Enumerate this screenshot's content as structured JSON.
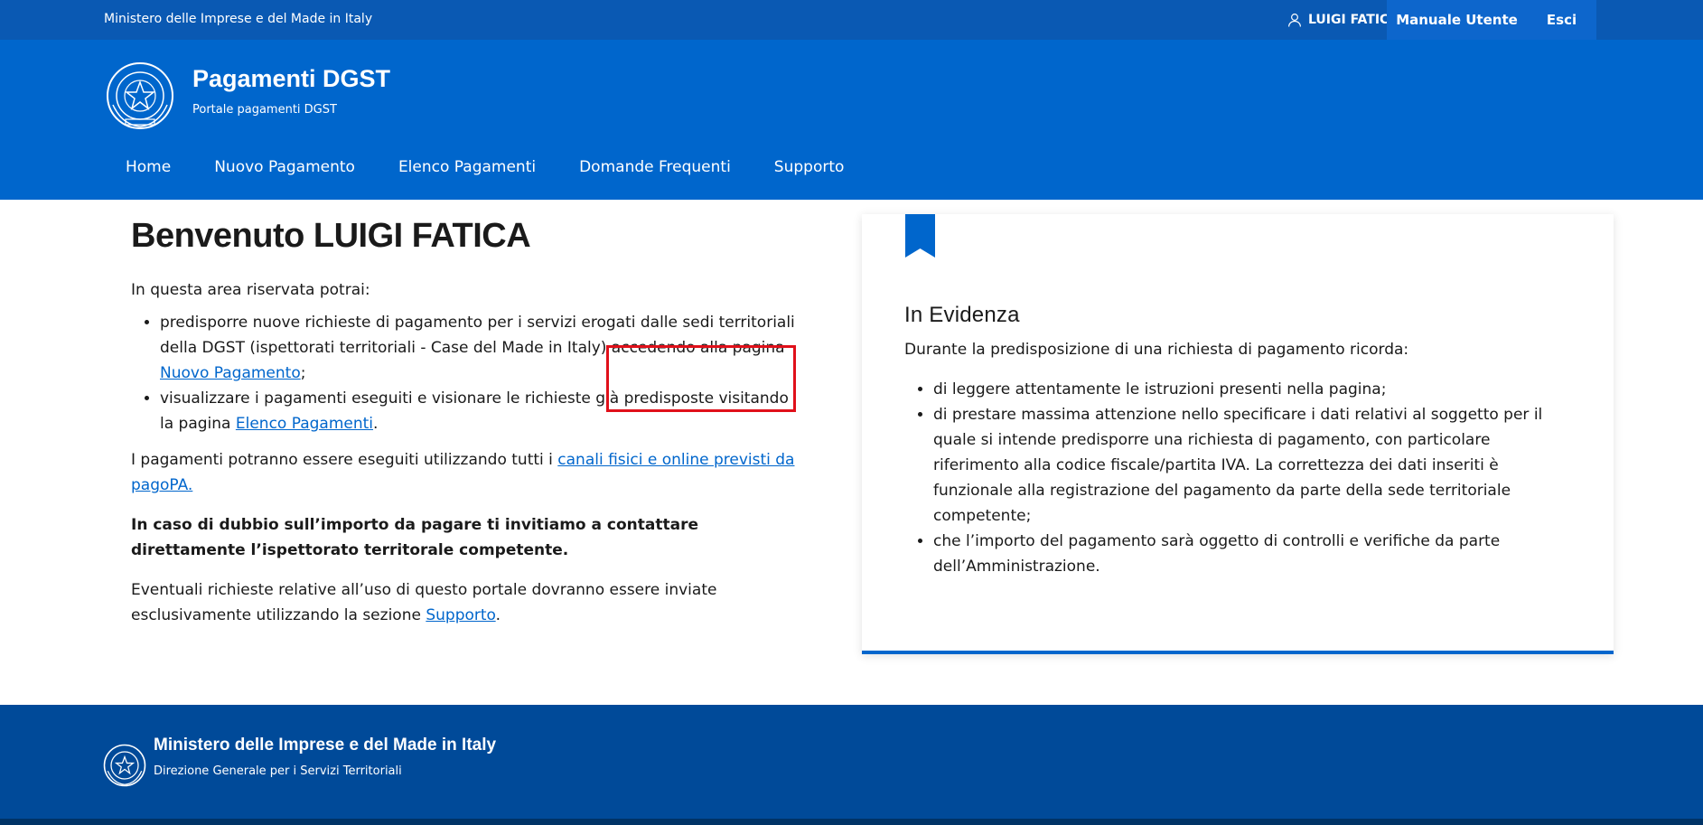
{
  "topbar": {
    "ministry": "Ministero delle Imprese e del Made in Italy",
    "user_name": "LUIGI FATICA",
    "manual_label": "Manuale Utente",
    "logout_label": "Esci"
  },
  "header": {
    "title": "Pagamenti DGST",
    "subtitle": "Portale pagamenti DGST"
  },
  "nav": {
    "items": [
      "Home",
      "Nuovo Pagamento",
      "Elenco Pagamenti",
      "Domande Frequenti",
      "Supporto"
    ]
  },
  "main": {
    "welcome": "Benvenuto LUIGI FATICA",
    "intro": "In questa area riservata potrai:",
    "bullet1_text": "predisporre nuove richieste di pagamento per i servizi erogati dalle sedi territoriali della DGST (ispettorati territoriali - Case del Made in Italy) accedendo alla pagina ",
    "bullet1_link": "Nuovo Pagamento",
    "bullet1_end": ";",
    "bullet2_text": "visualizzare i pagamenti eseguiti e visionare le richieste già predisposte visitando la pagina ",
    "bullet2_link": "Elenco Pagamenti",
    "bullet2_end": ".",
    "payments_text": "I pagamenti potranno essere eseguiti utilizzando tutti i ",
    "payments_link": "canali fisici e online previsti da pagoPA.",
    "doubt_note": "In caso di dubbio sull’importo da pagare ti invitiamo a contattare direttamente l’ispettorato territorale competente.",
    "support_text": "Eventuali richieste relative all’uso di questo portale dovranno essere inviate esclusivamente utilizzando la sezione ",
    "support_link": "Supporto",
    "support_end": "."
  },
  "card": {
    "title": "In Evidenza",
    "lead": "Durante la predisposizione di una richiesta di pagamento ricorda:",
    "items": [
      "di leggere attentamente le istruzioni presenti nella pagina;",
      "di prestare massima attenzione nello specificare i dati relativi al soggetto per il quale si intende predisporre una richiesta di pagamento, con particolare riferimento alla codice fiscale/partita IVA. La correttezza dei dati inseriti è funzionale alla registrazione del pagamento da parte della sede territoriale competente;",
      "che l’importo del pagamento sarà oggetto di controlli e verifiche da parte dell’Amministrazione."
    ]
  },
  "footer": {
    "title": "Ministero delle Imprese e del Made in Italy",
    "subtitle": "Direzione Generale per i Servizi Territoriali"
  },
  "colors": {
    "topbar": "#0a59b3",
    "header": "#0066cc",
    "footer": "#004a99",
    "highlight": "#e0101a"
  },
  "icons": [
    "user-icon",
    "emblem-logo",
    "bookmark-icon"
  ]
}
